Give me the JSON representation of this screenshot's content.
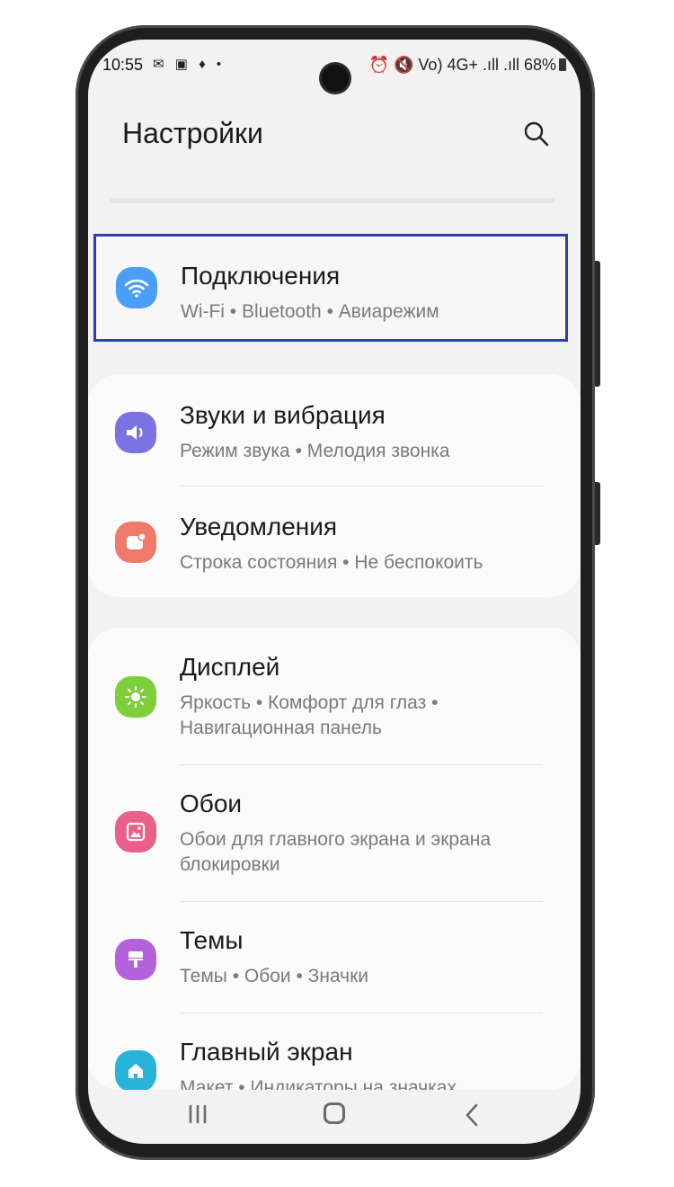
{
  "status_bar": {
    "time": "10:55",
    "notification_icons": "✉ ▣ ♦ •",
    "right": "⏰ 🔇 Vo) 4G+ .ıll .ıll 68%"
  },
  "header": {
    "title": "Настройки",
    "search_icon": "search-icon"
  },
  "items": [
    {
      "title": "Подключения",
      "subtitle": "Wi-Fi • Bluetooth • Авиарежим",
      "icon": "wifi-icon",
      "color": "#4a9ff5"
    },
    {
      "title": "Звуки и вибрация",
      "subtitle": "Режим звука • Мелодия звонка",
      "icon": "volume-icon",
      "color": "#7b72e3"
    },
    {
      "title": "Уведомления",
      "subtitle": "Строка состояния • Не беспокоить",
      "icon": "notification-icon",
      "color": "#f07a6a"
    },
    {
      "title": "Дисплей",
      "subtitle_line1": "Яркость • Комфорт для глаз •",
      "subtitle_line2": "Навигационная панель",
      "icon": "brightness-icon",
      "color": "#7fcf3c"
    },
    {
      "title": "Обои",
      "subtitle_line1": "Обои для главного экрана и экрана",
      "subtitle_line2": "блокировки",
      "icon": "wallpaper-icon",
      "color": "#e9618a"
    },
    {
      "title": "Темы",
      "subtitle": "Темы • Обои • Значки",
      "icon": "themes-icon",
      "color": "#b362d9"
    },
    {
      "title": "Главный экран",
      "subtitle": "Макет • Индикаторы на значках",
      "icon": "home-icon",
      "color": "#2ab3d8"
    }
  ],
  "colors": {
    "highlight_border": "#2f3eb7",
    "background": "#f2f2f2"
  },
  "navbar": {
    "recent": "recent-apps-icon",
    "home": "home-button-icon",
    "back": "back-icon"
  }
}
